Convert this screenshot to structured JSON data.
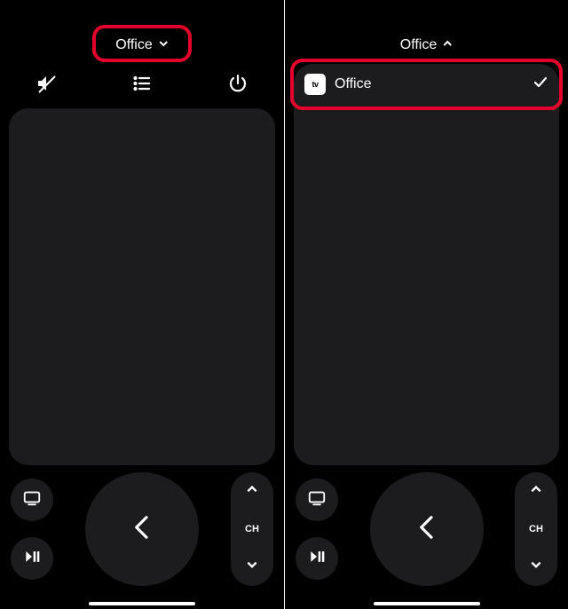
{
  "colors": {
    "annotation": "#e4002b",
    "surface": "#1c1c1e"
  },
  "left": {
    "selector": {
      "label": "Office",
      "chevron": "down"
    },
    "icons": {
      "mute": "mute-icon",
      "list": "list-icon",
      "power": "power-icon"
    }
  },
  "right": {
    "selector": {
      "label": "Office",
      "chevron": "up"
    },
    "device_list": [
      {
        "icon": "appletv",
        "label": "Office",
        "selected": true
      }
    ]
  },
  "controls": {
    "tv_button": "tv-icon",
    "play_pause": "play-pause-icon",
    "back": "back-icon",
    "channel_label": "CH"
  },
  "appletv_icon_text": "tv"
}
